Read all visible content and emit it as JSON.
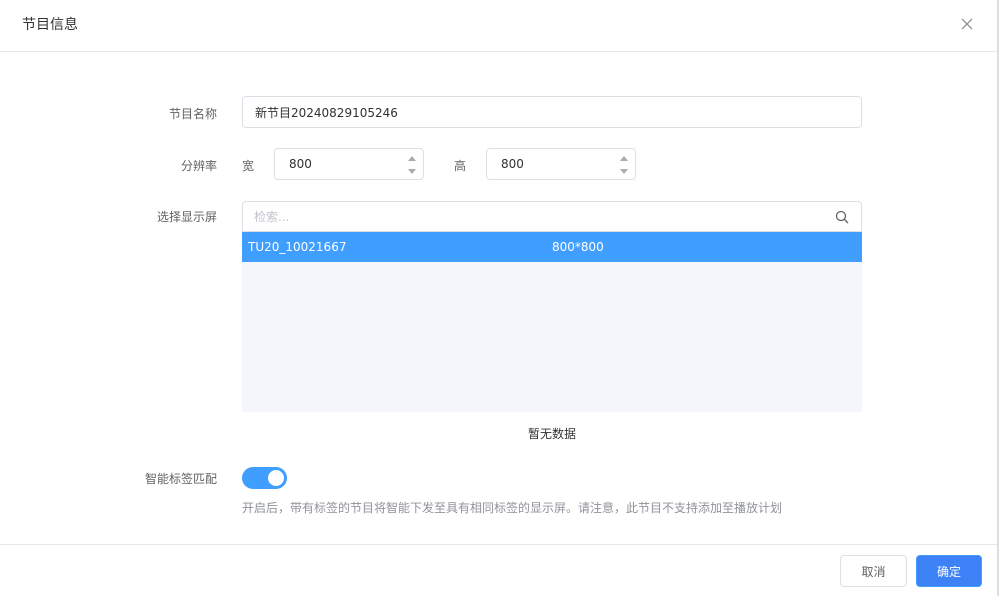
{
  "dialog": {
    "title": "节目信息"
  },
  "form": {
    "name_label": "节目名称",
    "name_value": "新节目20240829105246",
    "resolution_label": "分辨率",
    "width_label": "宽",
    "width_value": "800",
    "height_label": "高",
    "height_value": "800",
    "screen_label": "选择显示屏",
    "search_placeholder": "检索...",
    "screens": [
      {
        "name": "TU20_10021667",
        "resolution": "800*800",
        "selected": true
      }
    ],
    "empty_text": "暂无数据",
    "smart_tag_label": "智能标签匹配",
    "smart_tag_enabled": true,
    "smart_tag_hint": "开启后，带有标签的节目将智能下发至具有相同标签的显示屏。请注意，此节目不支持添加至播放计划"
  },
  "footer": {
    "cancel_label": "取消",
    "confirm_label": "确定"
  },
  "colors": {
    "primary": "#409eff",
    "confirm": "#3c82f6",
    "list_bg": "#f4f6fb",
    "border": "#dcdfe6"
  }
}
